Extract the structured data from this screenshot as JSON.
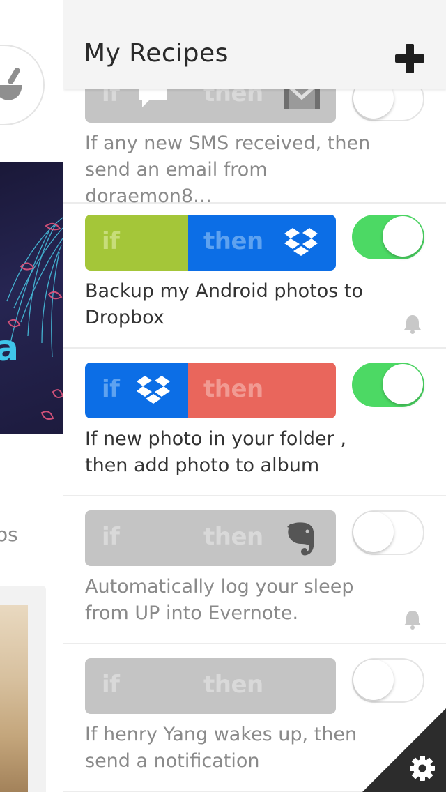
{
  "left_screen": {
    "hero_text": "a",
    "partial_text": "os"
  },
  "header": {
    "title": "My Recipes",
    "add_icon": "plus-icon"
  },
  "pill_labels": {
    "if": "if",
    "then": "then"
  },
  "recipes": [
    {
      "description": "If any new SMS received, then send an email from doraemon8…",
      "if_color": "#c4c4c4",
      "then_color": "#c4c4c4",
      "trigger_icon": "sms-bubble-icon",
      "action_icon": "gmail-icon",
      "enabled": false,
      "notifications": false
    },
    {
      "description": "Backup my Android photos to Dropbox",
      "if_color": "#a4c639",
      "then_color": "#0c6ee6",
      "trigger_icon": "",
      "action_icon": "dropbox-icon",
      "enabled": true,
      "notifications": true
    },
    {
      "description": "If new photo in your folder , then add photo to album",
      "if_color": "#0c6ee6",
      "then_color": "#e9665c",
      "trigger_icon": "dropbox-icon",
      "action_icon": "",
      "enabled": true,
      "notifications": false
    },
    {
      "description": "Automatically log your sleep from UP into Evernote.",
      "if_color": "#c4c4c4",
      "then_color": "#c4c4c4",
      "trigger_icon": "",
      "action_icon": "evernote-icon",
      "enabled": false,
      "notifications": true
    },
    {
      "description": "If henry Yang wakes up, then send a notification",
      "if_color": "#c4c4c4",
      "then_color": "#c4c4c4",
      "trigger_icon": "",
      "action_icon": "",
      "enabled": false,
      "notifications": false
    }
  ],
  "settings": {
    "icon": "gear-icon"
  }
}
